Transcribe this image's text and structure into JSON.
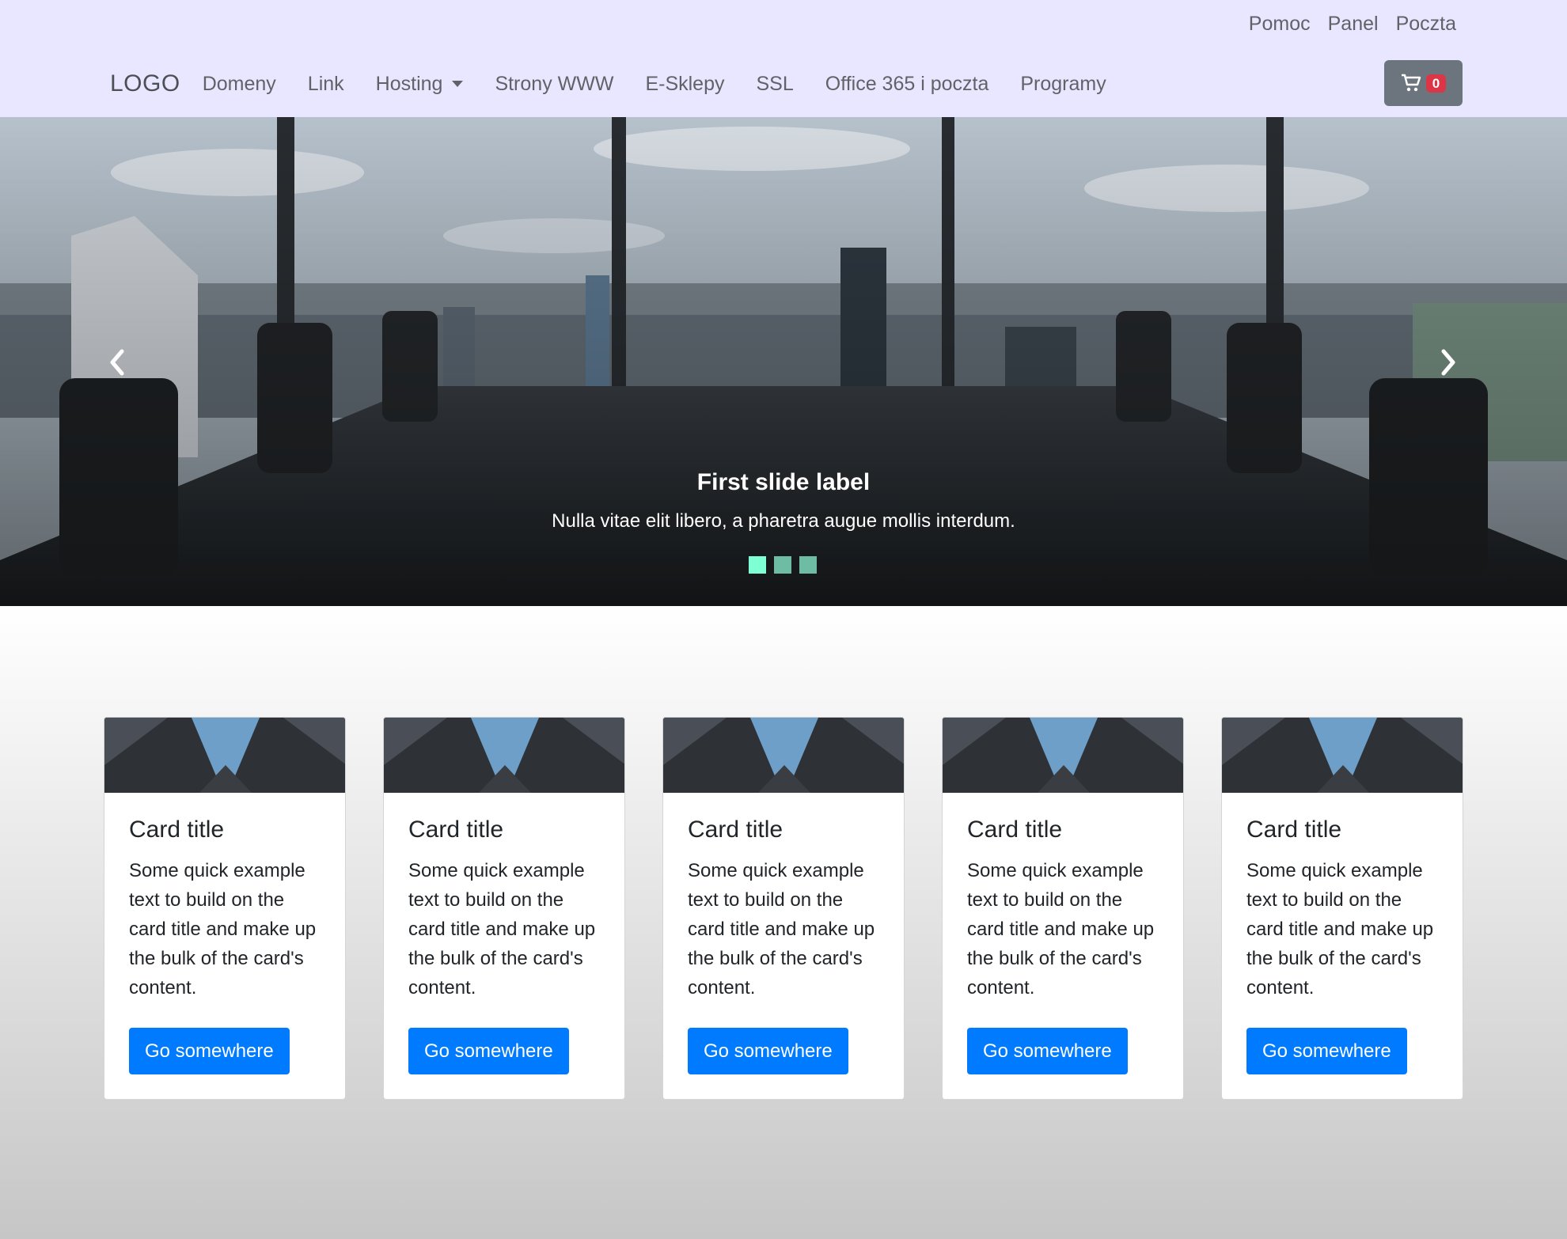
{
  "header": {
    "util_links": [
      "Pomoc",
      "Panel",
      "Poczta"
    ],
    "logo": "LOGO",
    "nav_items": [
      {
        "label": "Domeny",
        "dropdown": false
      },
      {
        "label": "Link",
        "dropdown": false
      },
      {
        "label": "Hosting",
        "dropdown": true
      },
      {
        "label": "Strony WWW",
        "dropdown": false
      },
      {
        "label": "E-Sklepy",
        "dropdown": false
      },
      {
        "label": "SSL",
        "dropdown": false
      },
      {
        "label": "Office 365 i poczta",
        "dropdown": false
      },
      {
        "label": "Programy",
        "dropdown": false
      }
    ],
    "cart": {
      "icon": "cart-icon",
      "count": "0",
      "badge_color": "#dc3545"
    }
  },
  "carousel": {
    "caption_title": "First slide label",
    "caption_text": "Nulla vitae elit libero, a pharetra augue mollis interdum.",
    "indicators": 3,
    "active_index": 0,
    "prev_icon": "chevron-left-icon",
    "next_icon": "chevron-right-icon"
  },
  "cards": [
    {
      "title": "Card title",
      "text": "Some quick example text to build on the card title and make up the bulk of the card's content.",
      "button": "Go somewhere"
    },
    {
      "title": "Card title",
      "text": "Some quick example text to build on the card title and make up the bulk of the card's content.",
      "button": "Go somewhere"
    },
    {
      "title": "Card title",
      "text": "Some quick example text to build on the card title and make up the bulk of the card's content.",
      "button": "Go somewhere"
    },
    {
      "title": "Card title",
      "text": "Some quick example text to build on the card title and make up the bulk of the card's content.",
      "button": "Go somewhere"
    },
    {
      "title": "Card title",
      "text": "Some quick example text to build on the card title and make up the bulk of the card's content.",
      "button": "Go somewhere"
    }
  ],
  "colors": {
    "header_bg": "#e9e7ff",
    "primary": "#007bff",
    "cart_button": "#6c757d",
    "indicator_active": "#7fffd4",
    "indicator": "#6fbca4"
  }
}
